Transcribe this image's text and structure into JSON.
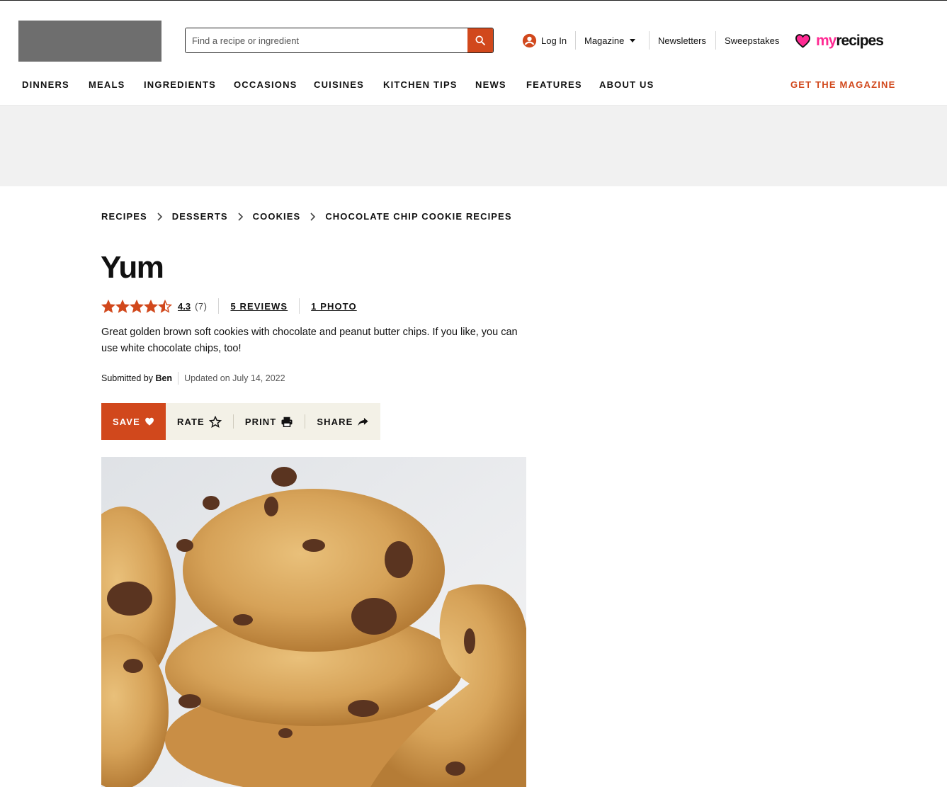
{
  "header": {
    "search": {
      "placeholder": "Find a recipe or ingredient",
      "button_icon": "search-icon"
    },
    "utility": {
      "login_label": "Log In",
      "magazine_label": "Magazine",
      "newsletters_label": "Newsletters",
      "sweepstakes_label": "Sweepstakes"
    },
    "brand": {
      "my": "my",
      "recipes": "recipes",
      "icon": "heart-icon"
    }
  },
  "nav": {
    "items": [
      "DINNERS",
      "MEALS",
      "INGREDIENTS",
      "OCCASIONS",
      "CUISINES",
      "KITCHEN TIPS",
      "NEWS",
      "FEATURES",
      "ABOUT US"
    ],
    "cta": "GET THE MAGAZINE"
  },
  "breadcrumb": [
    "RECIPES",
    "DESSERTS",
    "COOKIES",
    "CHOCOLATE CHIP COOKIE RECIPES"
  ],
  "recipe": {
    "title": "Yum",
    "rating": {
      "value": "4.3",
      "count": "(7)",
      "stars": 4.3
    },
    "reviews_link": "5 REVIEWS",
    "photos_link": "1 PHOTO",
    "description": "Great golden brown soft cookies with chocolate and peanut butter chips. If you like, you can use white chocolate chips, too!",
    "submitted_prefix": "Submitted by",
    "author": "Ben",
    "updated": "Updated on July 14, 2022"
  },
  "actions": {
    "save": "SAVE",
    "rate": "RATE",
    "print": "PRINT",
    "share": "SHARE"
  },
  "colors": {
    "accent": "#d1481c",
    "brand_pink": "#ff2a93",
    "action_bar_bg": "#f3f1e7",
    "ad_band_bg": "#f1f1f1"
  }
}
